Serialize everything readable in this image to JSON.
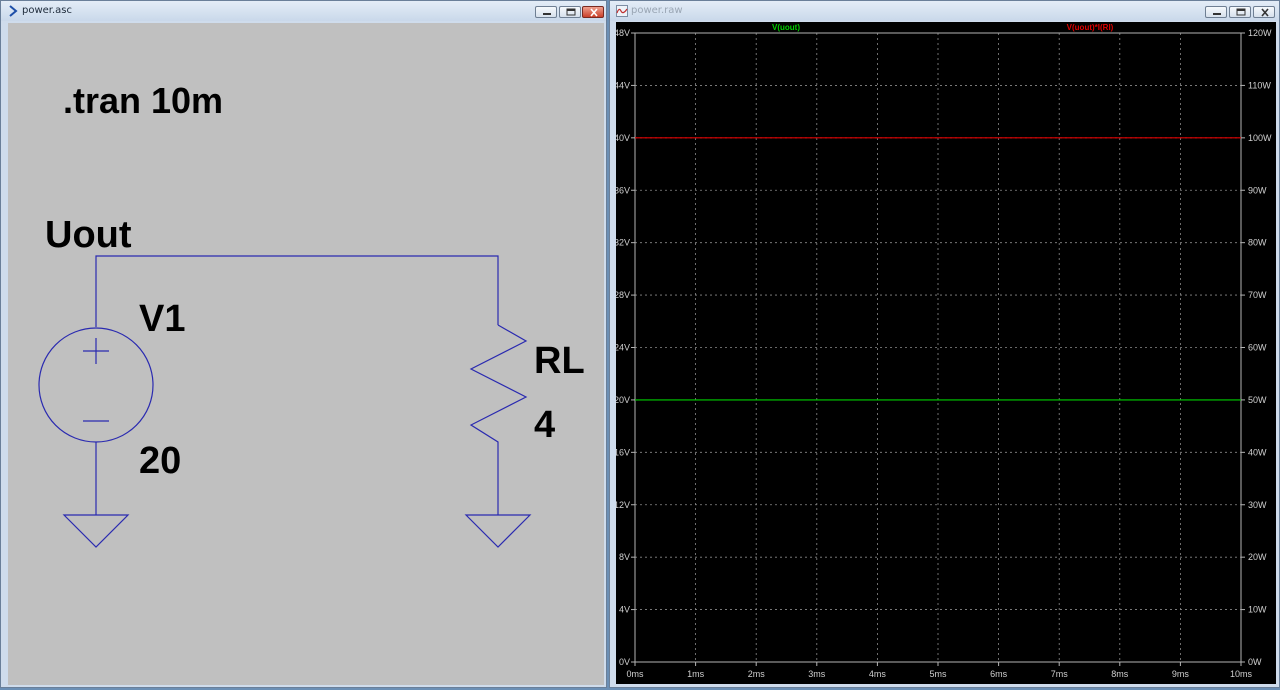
{
  "schematic_window": {
    "title": "power.asc",
    "directive": ".tran 10m",
    "net_label": "Uout",
    "source": {
      "name": "V1",
      "value": "20"
    },
    "resistor": {
      "name": "RL",
      "value": "4"
    },
    "wire_color": "#2a2ab0"
  },
  "plot_window": {
    "title": "power.raw",
    "background": "#000000"
  },
  "chart_data": {
    "type": "line",
    "title": "",
    "x": [
      0,
      10
    ],
    "x_unit": "ms",
    "x_tick_labels": [
      "0ms",
      "1ms",
      "2ms",
      "3ms",
      "4ms",
      "5ms",
      "6ms",
      "7ms",
      "8ms",
      "9ms",
      "10ms"
    ],
    "xlim": [
      0,
      10
    ],
    "y_left_tick_labels": [
      "0V",
      "4V",
      "8V",
      "12V",
      "16V",
      "20V",
      "24V",
      "28V",
      "32V",
      "36V",
      "40V",
      "44V",
      "48V"
    ],
    "ylim_left": [
      0,
      48
    ],
    "y_right_tick_labels": [
      "0W",
      "10W",
      "20W",
      "30W",
      "40W",
      "50W",
      "60W",
      "70W",
      "80W",
      "90W",
      "100W",
      "110W",
      "120W"
    ],
    "ylim_right": [
      0,
      120
    ],
    "grid": true,
    "series": [
      {
        "name": "V(uout)",
        "axis": "left",
        "color": "#00d000",
        "values": [
          20,
          20
        ]
      },
      {
        "name": "V(uout)*I(Rl)",
        "axis": "right",
        "color": "#e00000",
        "values": [
          100,
          100
        ]
      }
    ]
  }
}
